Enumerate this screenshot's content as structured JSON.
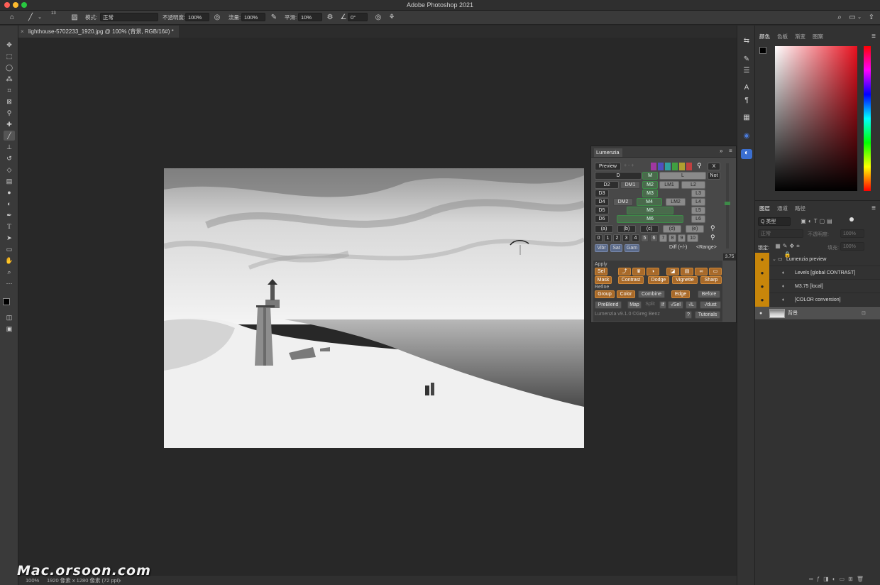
{
  "app": {
    "title": "Adobe Photoshop 2021"
  },
  "options": {
    "brush_size": "13",
    "mode_label": "模式:",
    "mode_value": "正常",
    "opacity_label": "不透明度:",
    "opacity_value": "100%",
    "flow_label": "流量:",
    "flow_value": "100%",
    "smoothing_label": "平滑:",
    "smoothing_value": "10%",
    "angle_value": "0°"
  },
  "document": {
    "tab_title": "lighthouse-5702233_1920.jpg @ 100% (背景, RGB/16#) *"
  },
  "status": {
    "zoom": "100%",
    "info": "1920 像素 x 1280 像素 (72 ppi)",
    "arrow": "›"
  },
  "watermark": "Mac.orsoon.com",
  "color_panel": {
    "tabs": [
      "颜色",
      "色板",
      "渐变",
      "图案"
    ]
  },
  "layers_panel": {
    "tabs": [
      "图层",
      "通道",
      "路径"
    ],
    "filter_label": "Q 类型",
    "blend_mode": "正常",
    "opacity_label": "不透明度:",
    "opacity_value": "100%",
    "lock_label": "锁定:",
    "fill_label": "填充:",
    "fill_value": "100%",
    "layers": [
      {
        "name": "Lumenzia preview",
        "type": "group"
      },
      {
        "name": "Levels [global CONTRAST]",
        "type": "adjustment"
      },
      {
        "name": "M3.75 [local]",
        "type": "adjustment"
      },
      {
        "name": "[COLOR conversion]",
        "type": "adjustment"
      },
      {
        "name": "背景",
        "type": "background"
      }
    ]
  },
  "lumenzia": {
    "title": "Lumenzia",
    "preview": "Preview",
    "x": "X",
    "not": "Not",
    "value": "3.75",
    "row_d": [
      "D",
      "D2",
      "D3",
      "D4",
      "D5",
      "D6"
    ],
    "row_dm": [
      "DM1",
      "DM2"
    ],
    "row_m": [
      "M",
      "M2",
      "M3",
      "M4",
      "M5",
      "M6"
    ],
    "row_lm": [
      "LM1",
      "LM2"
    ],
    "row_l": [
      "L",
      "L2",
      "L3",
      "L4",
      "L5",
      "L6"
    ],
    "zones": [
      "(a)",
      "(b)",
      "(c)",
      "(d)",
      "(e)"
    ],
    "digits": [
      "0",
      "1",
      "2",
      "3",
      "4",
      "5",
      "6",
      "7",
      "8",
      "9",
      "10"
    ],
    "vibr": "Vibr",
    "sat": "Sat",
    "gam": "Gam",
    "diff": "Diff (+/-)",
    "range": "<Range>",
    "apply_label": "Apply",
    "sel": "Sel",
    "apply_row": [
      "Mask",
      "Contrast",
      "Dodge",
      "Vignette",
      "Sharp"
    ],
    "refine_label": "Refine",
    "refine_row": [
      "Group",
      "Color",
      "Combine",
      "Edge",
      "Before"
    ],
    "bottom_row": [
      "PreBlend",
      "Map",
      "Split",
      "If",
      "√Sel",
      "√L",
      "√dust"
    ],
    "footer": "Lumenzia v9.1.0 ©Greg Benz",
    "help": "?",
    "tutorials": "Tutorials"
  },
  "colors": {
    "accent_orange": "#c8860a",
    "panel_green": "#3d8a48"
  }
}
